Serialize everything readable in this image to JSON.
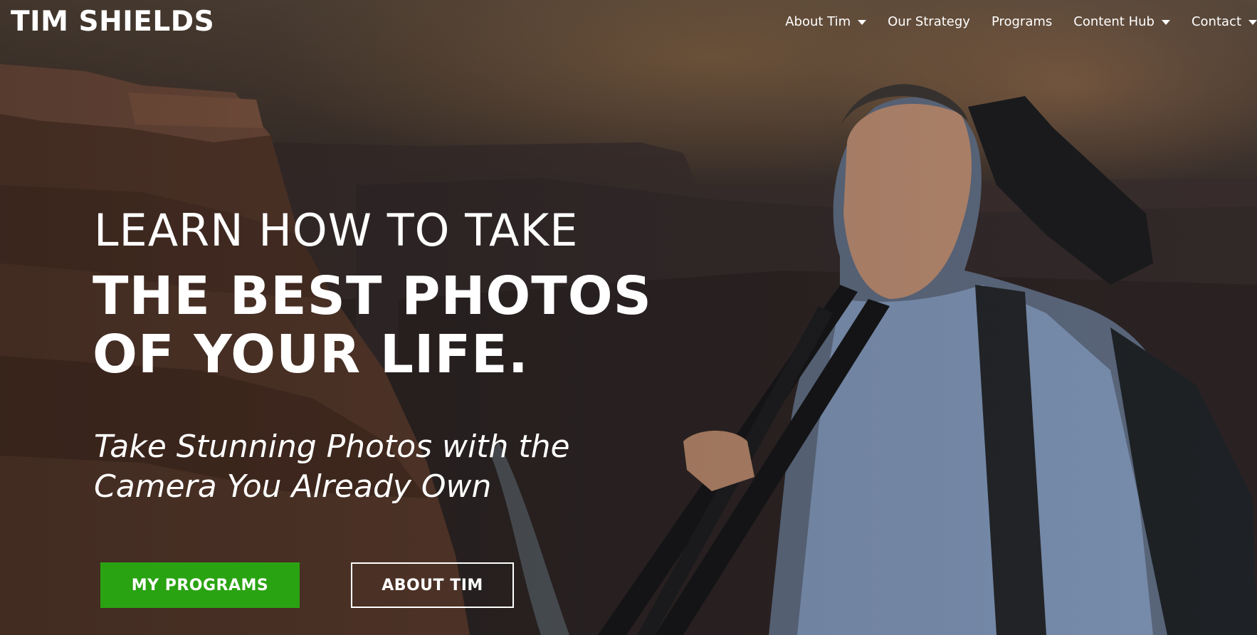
{
  "header": {
    "logo": "TIM SHIELDS",
    "nav": [
      {
        "label": "About Tim",
        "has_dropdown": true
      },
      {
        "label": "Our Strategy",
        "has_dropdown": false
      },
      {
        "label": "Programs",
        "has_dropdown": false
      },
      {
        "label": "Content Hub",
        "has_dropdown": true
      },
      {
        "label": "Contact",
        "has_dropdown": true
      }
    ]
  },
  "hero": {
    "eyebrow": "LEARN HOW TO TAKE",
    "headline_line1": "THE BEST PHOTOS",
    "headline_line2": "OF YOUR LIFE.",
    "subtitle_line1": "Take Stunning Photos with the",
    "subtitle_line2": "Camera You Already Own",
    "primary_button": "MY PROGRAMS",
    "secondary_button": "ABOUT TIM"
  },
  "colors": {
    "primary_button": "#2aa312",
    "text": "#ffffff"
  }
}
